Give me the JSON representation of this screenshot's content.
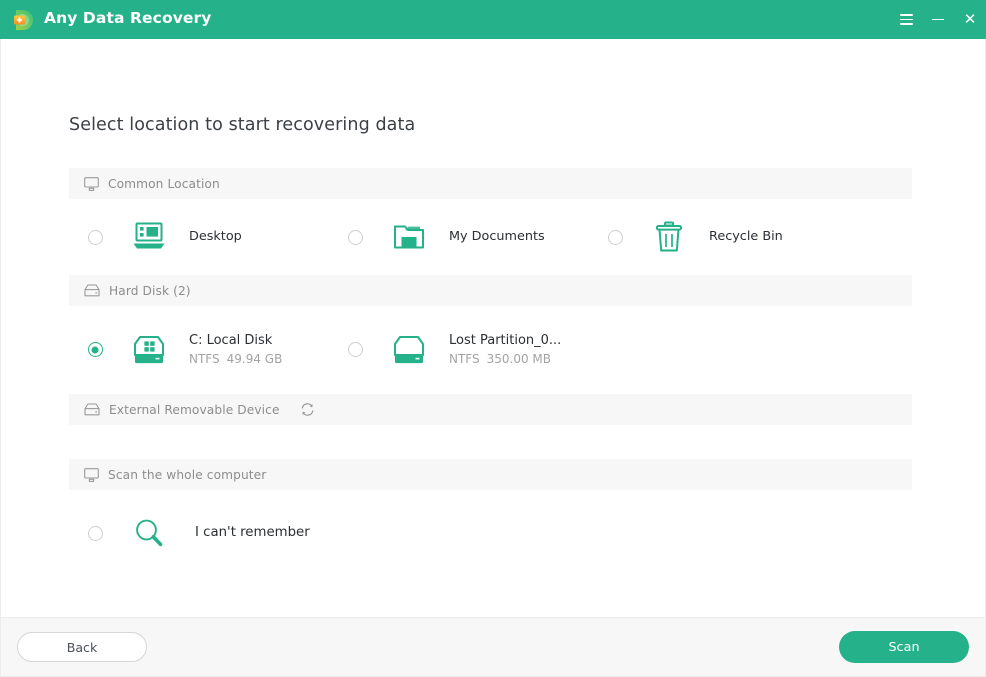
{
  "window": {
    "app_title": "Any Data Recovery",
    "logo_icon": "data-recovery-plus-logo",
    "controls": {
      "menu_icon": "hamburger-menu-icon",
      "minimize_icon": "minimize-icon",
      "close_icon": "close-icon"
    },
    "accent_color": "#25b189",
    "header_bg_color": "#25b189",
    "section_bg_color": "#f7f7f7",
    "footer_bg_color": "#f7f7f7"
  },
  "page": {
    "title": "Select location to start recovering data"
  },
  "sections": [
    {
      "id": "common-location",
      "icon": "monitor-icon",
      "label": "Common Location",
      "items": [
        {
          "id": "desktop",
          "icon": "desktop-monitor-icon",
          "label": "Desktop",
          "sub": null,
          "selected": false
        },
        {
          "id": "my-documents",
          "icon": "folder-icon",
          "label": "My Documents",
          "sub": null,
          "selected": false
        },
        {
          "id": "recycle-bin",
          "icon": "trash-bin-icon",
          "label": "Recycle Bin",
          "sub": null,
          "selected": false
        }
      ]
    },
    {
      "id": "hard-disk",
      "icon": "hard-disk-icon",
      "label": "Hard Disk (2)",
      "items": [
        {
          "id": "c-local-disk",
          "icon": "windows-drive-icon",
          "label": "C: Local Disk",
          "fs": "NTFS",
          "size": "49.94 GB",
          "selected": true
        },
        {
          "id": "lost-partition",
          "icon": "partition-drive-icon",
          "label": "Lost Partition_0...",
          "fs": "NTFS",
          "size": "350.00 MB",
          "selected": false
        }
      ]
    },
    {
      "id": "external-removable-device",
      "icon": "hard-disk-icon",
      "label": "External Removable Device",
      "refresh_icon": "refresh-icon",
      "items": []
    },
    {
      "id": "scan-whole-computer",
      "icon": "monitor-icon",
      "label": "Scan the whole computer",
      "items": [
        {
          "id": "cant-remember",
          "icon": "magnifier-icon",
          "label": "I can't remember",
          "sub": null,
          "selected": false
        }
      ]
    }
  ],
  "footer": {
    "back_label": "Back",
    "scan_label": "Scan"
  }
}
